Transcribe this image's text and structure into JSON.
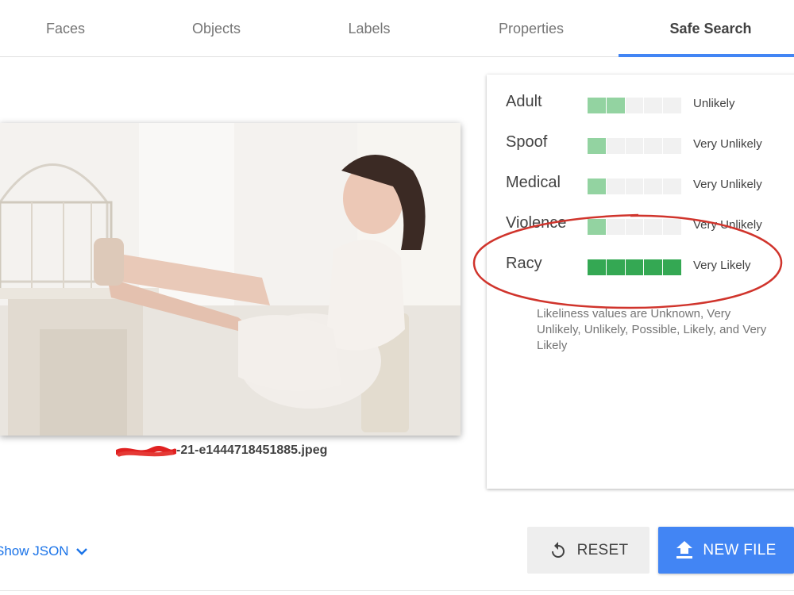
{
  "tabs": [
    {
      "label": "Faces"
    },
    {
      "label": "Objects"
    },
    {
      "label": "Labels"
    },
    {
      "label": "Properties"
    },
    {
      "label": "Safe Search"
    }
  ],
  "active_tab": "Safe Search",
  "image": {
    "filename_visible": "-21-e1444718451885.jpeg"
  },
  "safe_search": {
    "rows": [
      {
        "label": "Adult",
        "value": "Unlikely",
        "level": 2
      },
      {
        "label": "Spoof",
        "value": "Very Unlikely",
        "level": 1
      },
      {
        "label": "Medical",
        "value": "Very Unlikely",
        "level": 1
      },
      {
        "label": "Violence",
        "value": "Very Unlikely",
        "level": 1
      },
      {
        "label": "Racy",
        "value": "Very Likely",
        "level": 5
      }
    ],
    "segments_total": 5,
    "note": "Likeliness values are Unknown, Very Unlikely, Unlikely, Possible, Likely, and Very Likely",
    "colors": {
      "light": "#93d3a1",
      "strong": "#34a853",
      "empty": "#f1f1f1",
      "annotation": "#d0342c"
    }
  },
  "footer": {
    "show_json_label": "Show JSON",
    "reset_label": "RESET",
    "new_file_label": "NEW FILE"
  },
  "icons": {
    "show_json": "chevron-down-icon",
    "reset": "refresh-icon",
    "new_file": "upload-icon"
  },
  "accent_color": "#4285f4"
}
